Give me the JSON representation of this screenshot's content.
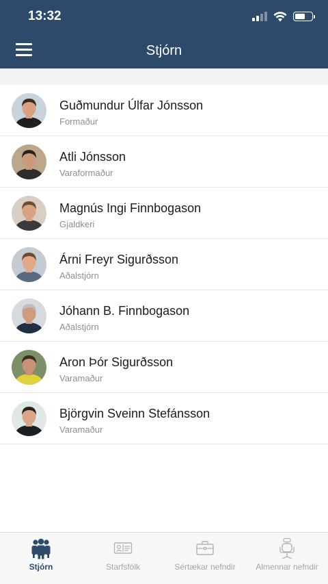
{
  "status_bar": {
    "time": "13:32",
    "battery_level": 0.65
  },
  "header": {
    "title": "Stjórn"
  },
  "members": [
    {
      "name": "Guðmundur Úlfar Jónsson",
      "role": "Formaður",
      "colors": {
        "bg": "#c9d3dc",
        "skin": "#d9a183",
        "hair": "#3a2a20",
        "shirt": "#1e1e1e"
      }
    },
    {
      "name": "Atli Jónsson",
      "role": "Varaformaður",
      "colors": {
        "bg": "#bba78c",
        "skin": "#cb9a7a",
        "hair": "#2a211b",
        "shirt": "#2d2d2d"
      }
    },
    {
      "name": "Magnús Ingi Finnbogason",
      "role": "Gjaldkeri",
      "colors": {
        "bg": "#d8cfc4",
        "skin": "#d7a383",
        "hair": "#6b4e34",
        "shirt": "#3a3a3a"
      }
    },
    {
      "name": "Árni Freyr Sigurðsson",
      "role": "Aðalstjórn",
      "colors": {
        "bg": "#c5cbd3",
        "skin": "#e0a887",
        "hair": "#6b4a2e",
        "shirt": "#5a6a80"
      }
    },
    {
      "name": "Jóhann B. Finnbogason",
      "role": "Aðalstjórn",
      "colors": {
        "bg": "#d6d9dd",
        "skin": "#cf9c7e",
        "hair": "#bdbdbd",
        "shirt": "#1f2f44"
      }
    },
    {
      "name": "Aron Þór Sigurðsson",
      "role": "Varamaður",
      "colors": {
        "bg": "#7d8f6a",
        "skin": "#c99274",
        "hair": "#3b2c22",
        "shirt": "#e0d23a"
      }
    },
    {
      "name": "Björgvin Sveinn Stefánsson",
      "role": "Varamaður",
      "colors": {
        "bg": "#dfe8e5",
        "skin": "#d9a687",
        "hair": "#2b2220",
        "shirt": "#1a1f24"
      }
    }
  ],
  "tabs": [
    {
      "label": "Stjórn",
      "icon": "group-icon",
      "active": true
    },
    {
      "label": "Starfsfólk",
      "icon": "id-card-icon",
      "active": false
    },
    {
      "label": "Sértækar nefndir",
      "icon": "briefcase-icon",
      "active": false
    },
    {
      "label": "Almennar nefndir",
      "icon": "chair-icon",
      "active": false
    }
  ],
  "colors": {
    "header_bg": "#2d4a6b",
    "active_tab": "#2d4a6b",
    "inactive_tab": "#a5a5a9"
  }
}
